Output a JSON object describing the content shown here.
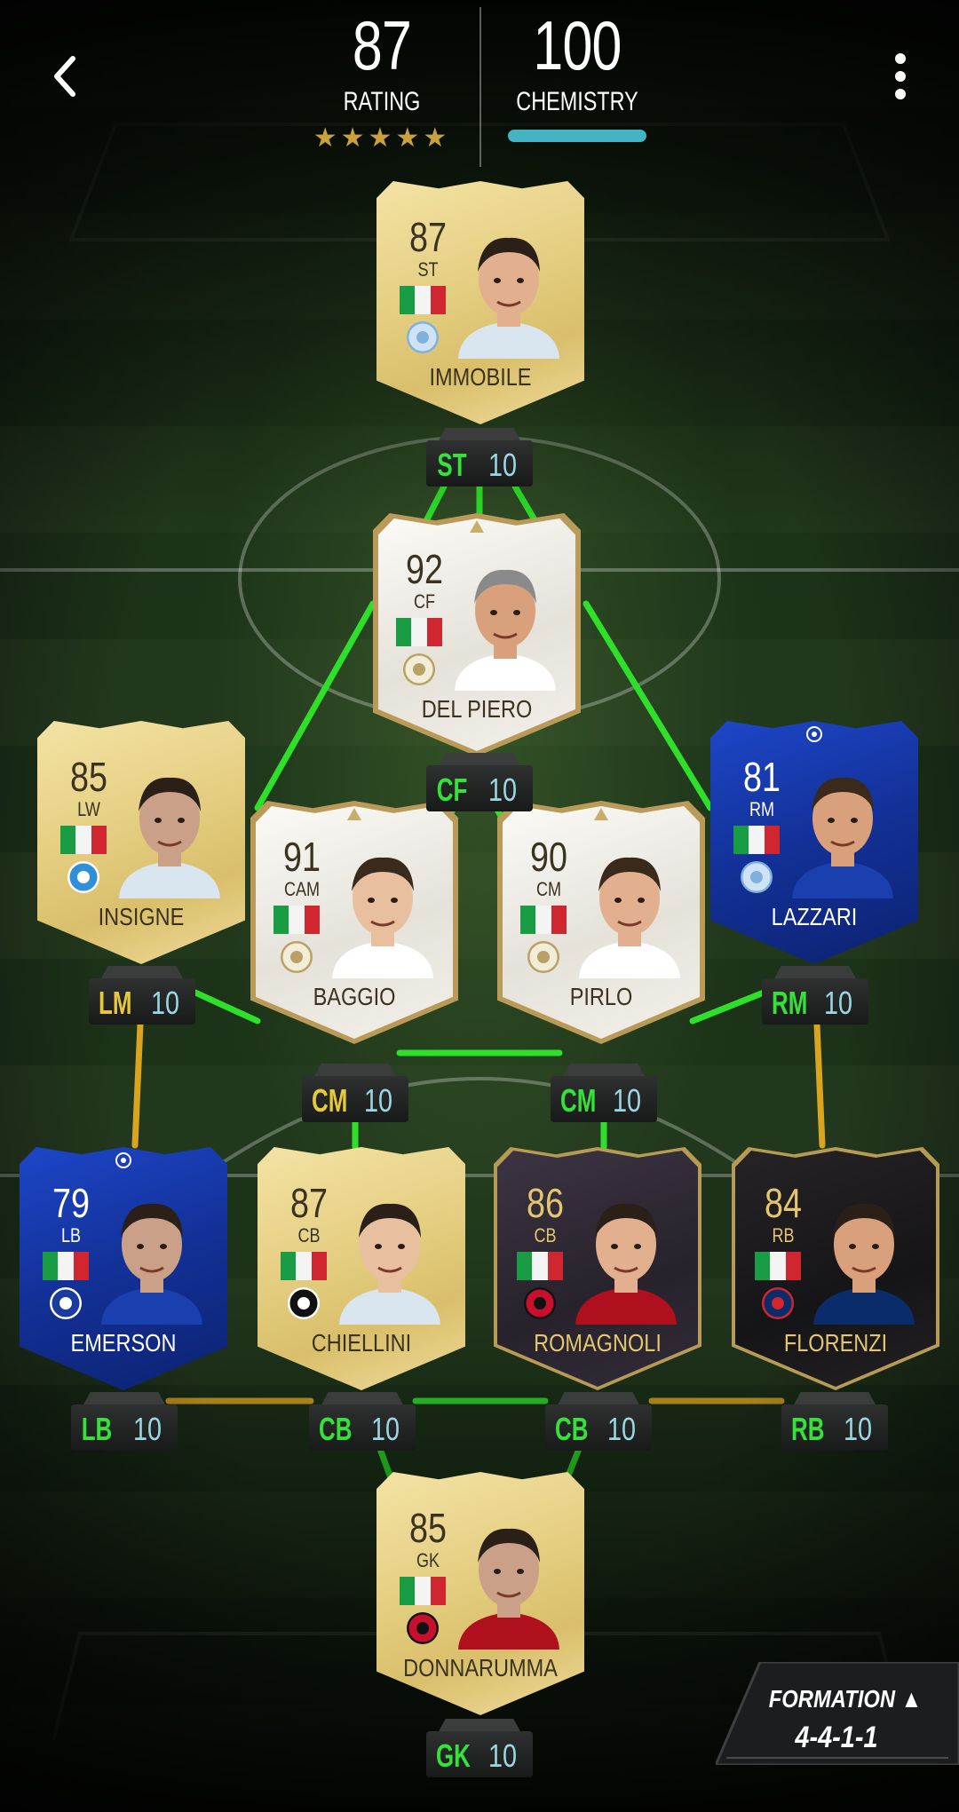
{
  "header": {
    "rating_value": "87",
    "rating_label": "RATING",
    "stars": "★★★★★",
    "chemistry_value": "100",
    "chemistry_label": "CHEMISTRY",
    "chemistry_level": 1.0,
    "chemistry_bar_color": "#44b3c2"
  },
  "players": [
    {
      "id": "immobile",
      "rating": "87",
      "position": "ST",
      "name": "IMMOBILE",
      "card": "gold",
      "club": "lazio",
      "nation": "italy"
    },
    {
      "id": "delpiero",
      "rating": "92",
      "position": "CF",
      "name": "DEL PIERO",
      "card": "icon",
      "club": "icon",
      "nation": "italy"
    },
    {
      "id": "insigne",
      "rating": "85",
      "position": "LW",
      "name": "INSIGNE",
      "card": "gold",
      "club": "napoli",
      "nation": "italy"
    },
    {
      "id": "baggio",
      "rating": "91",
      "position": "CAM",
      "name": "BAGGIO",
      "card": "icon",
      "club": "icon",
      "nation": "italy"
    },
    {
      "id": "pirlo",
      "rating": "90",
      "position": "CM",
      "name": "PIRLO",
      "card": "icon",
      "club": "icon",
      "nation": "italy"
    },
    {
      "id": "lazzari",
      "rating": "81",
      "position": "RM",
      "name": "LAZZARI",
      "card": "ucl",
      "club": "lazio",
      "nation": "italy"
    },
    {
      "id": "emerson",
      "rating": "79",
      "position": "LB",
      "name": "EMERSON",
      "card": "ucl",
      "club": "chelsea",
      "nation": "italy"
    },
    {
      "id": "chiellini",
      "rating": "87",
      "position": "CB",
      "name": "CHIELLINI",
      "card": "gold",
      "club": "piemonte",
      "nation": "italy"
    },
    {
      "id": "romagnoli",
      "rating": "86",
      "position": "CB",
      "name": "ROMAGNOLI",
      "card": "totw-purple",
      "club": "milan",
      "nation": "italy"
    },
    {
      "id": "florenzi",
      "rating": "84",
      "position": "RB",
      "name": "FLORENZI",
      "card": "totw",
      "club": "psg",
      "nation": "italy"
    },
    {
      "id": "donnarumma",
      "rating": "85",
      "position": "GK",
      "name": "DONNARUMMA",
      "card": "gold",
      "club": "milan",
      "nation": "italy"
    }
  ],
  "slots": [
    {
      "id": "st",
      "position": "ST",
      "chemistry": "10",
      "color": "green"
    },
    {
      "id": "cf",
      "position": "CF",
      "chemistry": "10",
      "color": "green"
    },
    {
      "id": "lm",
      "position": "LM",
      "chemistry": "10",
      "color": "yellow"
    },
    {
      "id": "rm",
      "position": "RM",
      "chemistry": "10",
      "color": "green"
    },
    {
      "id": "cm1",
      "position": "CM",
      "chemistry": "10",
      "color": "yellow"
    },
    {
      "id": "cm2",
      "position": "CM",
      "chemistry": "10",
      "color": "green"
    },
    {
      "id": "lb",
      "position": "LB",
      "chemistry": "10",
      "color": "green"
    },
    {
      "id": "cb1",
      "position": "CB",
      "chemistry": "10",
      "color": "green"
    },
    {
      "id": "cb2",
      "position": "CB",
      "chemistry": "10",
      "color": "green"
    },
    {
      "id": "rb",
      "position": "RB",
      "chemistry": "10",
      "color": "green"
    },
    {
      "id": "gk",
      "position": "GK",
      "chemistry": "10",
      "color": "green"
    }
  ],
  "formation": {
    "label": "FORMATION ▲",
    "value": "4-4-1-1"
  },
  "colors": {
    "link_green": "#2fe02a",
    "link_yellow": "#d9a520",
    "chip_chem": "#9ad7e4"
  },
  "icons": {
    "back": "chevron-left-icon",
    "menu": "more-vertical-icon"
  }
}
